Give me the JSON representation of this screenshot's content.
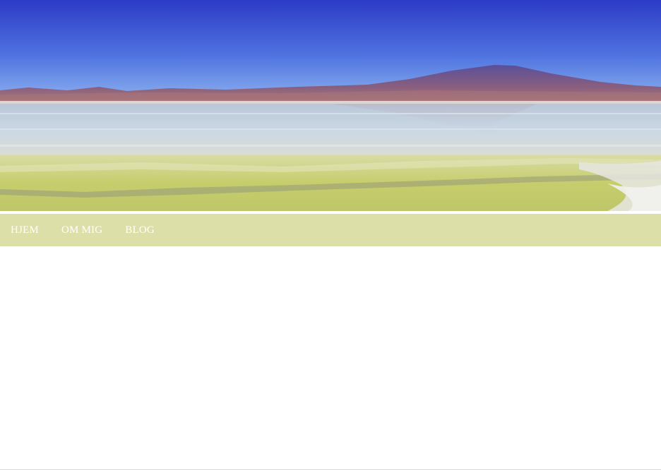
{
  "header": {
    "image_alt": "",
    "colors": {
      "sky_top": "#2f3fc8",
      "sky_bottom": "#7aa4ee",
      "mountain": "#7d5a78",
      "water": "#cfd6db",
      "shore": "#c9cf6a"
    }
  },
  "navigation": {
    "background": "#dcdfa8",
    "items": [
      {
        "label": "HJEM"
      },
      {
        "label": "OM MIG"
      },
      {
        "label": "BLOG"
      }
    ]
  }
}
